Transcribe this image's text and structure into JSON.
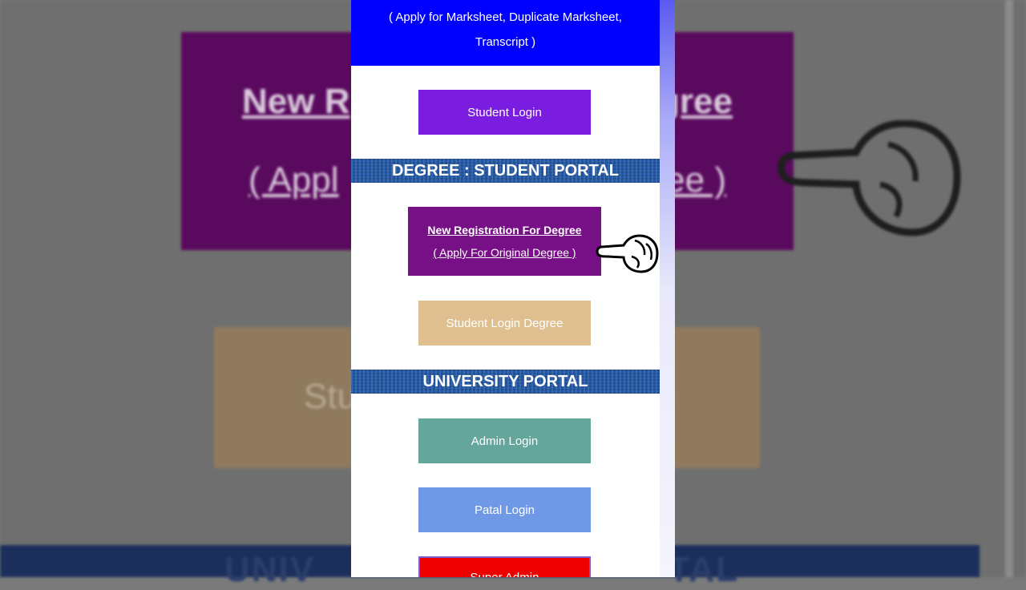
{
  "background": {
    "purple_text_left": "New R",
    "purple_text_right": "egree",
    "purple_sub_left": "( Appl",
    "purple_sub_right": "ee )",
    "tan_text": "Stu",
    "band_left": "UNIV",
    "band_right": "TAL"
  },
  "top_banner": {
    "line1": "( Apply for Marksheet, Duplicate Marksheet,",
    "line2": "Transcript )"
  },
  "buttons": {
    "student_login": "Student Login",
    "new_registration_title": "New Registration For Degree",
    "new_registration_sub": "( Apply For Original Degree )",
    "student_login_degree": "Student Login Degree",
    "admin_login": "Admin Login",
    "patal_login": "Patal Login",
    "super_admin": "Super Admin"
  },
  "sections": {
    "degree_portal": "DEGREE : STUDENT PORTAL",
    "university_portal": "UNIVERSITY PORTAL"
  },
  "colors": {
    "top_banner": "#0000ff",
    "student_login": "#7b1de0",
    "section_header": "#245aa8",
    "new_registration": "#770f86",
    "student_login_degree": "#dfbf8f",
    "admin_login": "#64a69c",
    "patal_login": "#6f98e6",
    "super_admin": "#ee0000"
  },
  "icons": {
    "pointer": "pointing-hand-icon"
  }
}
